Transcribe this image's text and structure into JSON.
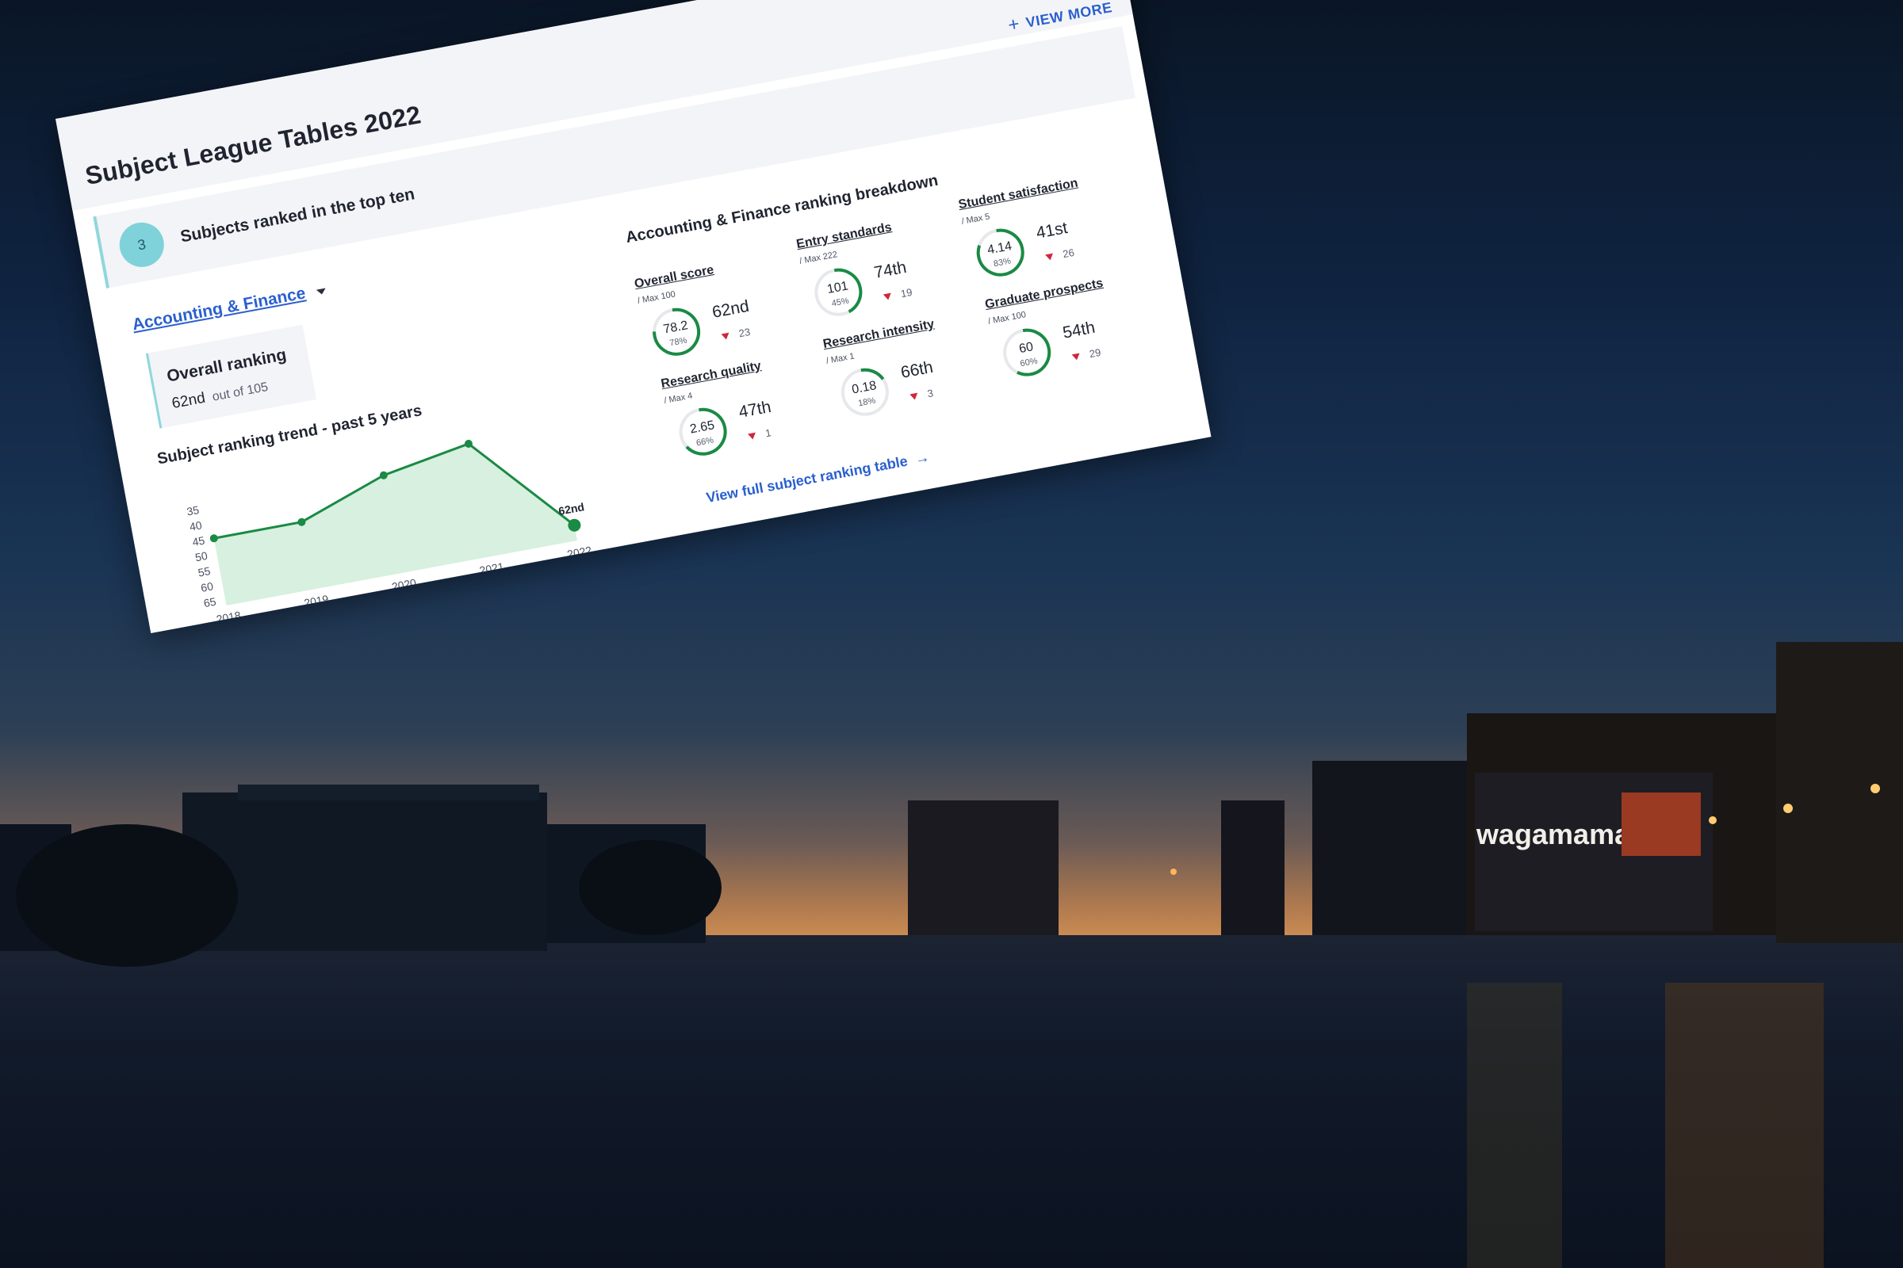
{
  "card": {
    "title": "Subject League Tables 2022",
    "view_more_label": "VIEW MORE",
    "top_ten": {
      "count": "3",
      "label": "Subjects ranked in the top ten"
    },
    "subject_selector": "Accounting & Finance",
    "overall_ranking": {
      "title": "Overall ranking",
      "value": "62nd",
      "out_of": "out of 105"
    },
    "trend_title": "Subject ranking trend - past 5 years",
    "breakdown_title": "Accounting & Finance ranking breakdown",
    "metrics": [
      {
        "name": "Overall score",
        "max": "/ Max 100",
        "score": "78.2",
        "pct": "78%",
        "fraction": 0.78,
        "rank": "62nd",
        "change": "23"
      },
      {
        "name": "Entry standards",
        "max": "/ Max 222",
        "score": "101",
        "pct": "45%",
        "fraction": 0.45,
        "rank": "74th",
        "change": "19"
      },
      {
        "name": "Student satisfaction",
        "max": "/ Max 5",
        "score": "4.14",
        "pct": "83%",
        "fraction": 0.83,
        "rank": "41st",
        "change": "26"
      },
      {
        "name": "Research quality",
        "max": "/ Max 4",
        "score": "2.65",
        "pct": "66%",
        "fraction": 0.66,
        "rank": "47th",
        "change": "1"
      },
      {
        "name": "Research intensity",
        "max": "/ Max 1",
        "score": "0.18",
        "pct": "18%",
        "fraction": 0.18,
        "rank": "66th",
        "change": "3"
      },
      {
        "name": "Graduate prospects",
        "max": "/ Max 100",
        "score": "60",
        "pct": "60%",
        "fraction": 0.6,
        "rank": "54th",
        "change": "29"
      }
    ],
    "full_table_link": "View full subject ranking table",
    "colors": {
      "accent_blue": "#2a5fcf",
      "ring_green": "#1a8a44",
      "teal": "#7fd2d9",
      "down_red": "#d0263a",
      "area_fill": "#d7f0df"
    }
  },
  "chart_data": {
    "type": "area",
    "title": "Subject ranking trend - past 5 years",
    "categories": [
      "2018",
      "2019",
      "2020",
      "2021",
      "2022"
    ],
    "values": [
      45,
      45,
      35,
      30,
      62
    ],
    "y_ticks": [
      35,
      40,
      45,
      50,
      55,
      60,
      65
    ],
    "ylim": [
      30,
      67
    ],
    "y_inverted": true,
    "last_point_label": "62nd",
    "grid": false
  },
  "background": {
    "restaurant_sign": "wagamama"
  }
}
